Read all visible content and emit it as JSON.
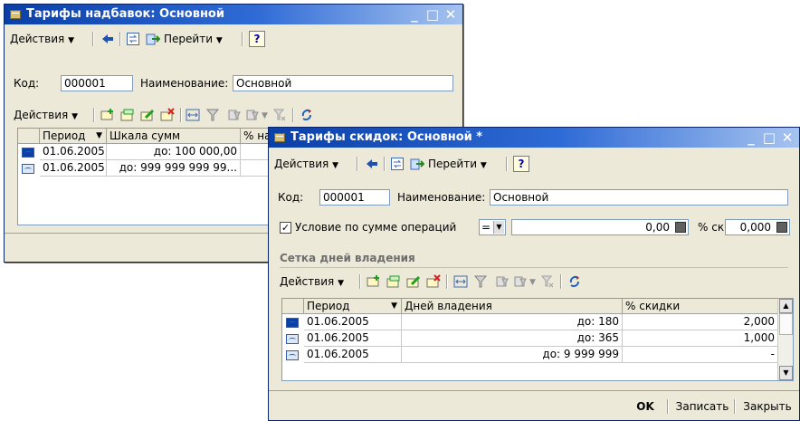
{
  "window1": {
    "title": "Тарифы надбавок: Основной",
    "toolbar": {
      "actions": "Действия",
      "goto": "Перейти",
      "help": "?"
    },
    "code_label": "Код:",
    "code_value": "000001",
    "name_label": "Наименование:",
    "name_value": "Основной",
    "table_toolbar": {
      "actions": "Действия"
    },
    "table": {
      "headers": [
        "Период",
        "Шкала сумм",
        "% на"
      ],
      "rows": [
        {
          "period": "01.06.2005",
          "scale": "до:  100 000,00"
        },
        {
          "period": "01.06.2005",
          "scale": "до:  999 999 999 99..."
        }
      ]
    }
  },
  "window2": {
    "title": "Тарифы скидок: Основной *",
    "toolbar": {
      "actions": "Действия",
      "goto": "Перейти",
      "help": "?"
    },
    "code_label": "Код:",
    "code_value": "000001",
    "name_label": "Наименование:",
    "name_value": "Основной",
    "condition_label": "Условие по сумме операций",
    "condition_checked": true,
    "operator_value": "=",
    "amount_value": "0,00",
    "discount_label": "% скидки:",
    "discount_value": "0,000",
    "section_title": "Сетка дней владения",
    "table_toolbar": {
      "actions": "Действия"
    },
    "table": {
      "headers": [
        "Период",
        "Дней владения",
        "% скидки"
      ],
      "rows": [
        {
          "period": "01.06.2005",
          "days": "до:  180",
          "discount": "2,000"
        },
        {
          "period": "01.06.2005",
          "days": "до:  365",
          "discount": "1,000"
        },
        {
          "period": "01.06.2005",
          "days": "до:  9 999 999",
          "discount": "-"
        }
      ]
    },
    "buttons": {
      "ok": "OK",
      "save": "Записать",
      "close": "Закрыть"
    }
  }
}
